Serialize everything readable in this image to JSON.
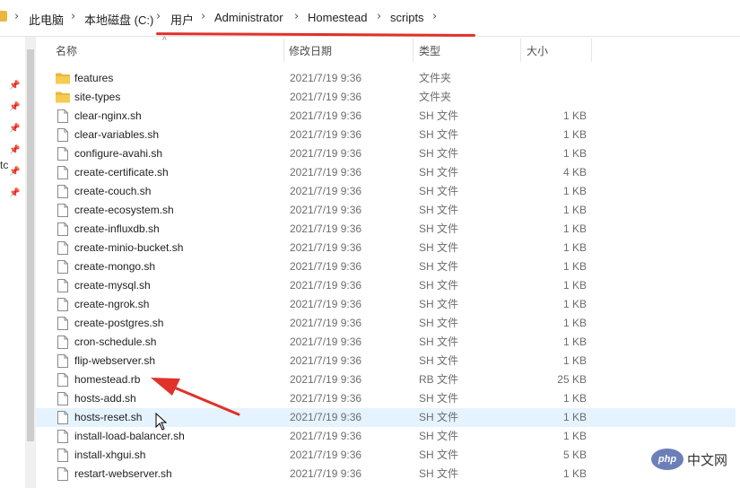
{
  "breadcrumb": [
    "此电脑",
    "本地磁盘 (C:)",
    "用户",
    "Administrator",
    "Homestead",
    "scripts"
  ],
  "columns": {
    "name": "名称",
    "date": "修改日期",
    "type": "类型",
    "size": "大小"
  },
  "nav_fragment": "tc",
  "files": [
    {
      "name": "features",
      "date": "2021/7/19 9:36",
      "type": "文件夹",
      "size": "",
      "kind": "folder"
    },
    {
      "name": "site-types",
      "date": "2021/7/19 9:36",
      "type": "文件夹",
      "size": "",
      "kind": "folder"
    },
    {
      "name": "clear-nginx.sh",
      "date": "2021/7/19 9:36",
      "type": "SH 文件",
      "size": "1 KB",
      "kind": "file"
    },
    {
      "name": "clear-variables.sh",
      "date": "2021/7/19 9:36",
      "type": "SH 文件",
      "size": "1 KB",
      "kind": "file"
    },
    {
      "name": "configure-avahi.sh",
      "date": "2021/7/19 9:36",
      "type": "SH 文件",
      "size": "1 KB",
      "kind": "file"
    },
    {
      "name": "create-certificate.sh",
      "date": "2021/7/19 9:36",
      "type": "SH 文件",
      "size": "4 KB",
      "kind": "file"
    },
    {
      "name": "create-couch.sh",
      "date": "2021/7/19 9:36",
      "type": "SH 文件",
      "size": "1 KB",
      "kind": "file"
    },
    {
      "name": "create-ecosystem.sh",
      "date": "2021/7/19 9:36",
      "type": "SH 文件",
      "size": "1 KB",
      "kind": "file"
    },
    {
      "name": "create-influxdb.sh",
      "date": "2021/7/19 9:36",
      "type": "SH 文件",
      "size": "1 KB",
      "kind": "file"
    },
    {
      "name": "create-minio-bucket.sh",
      "date": "2021/7/19 9:36",
      "type": "SH 文件",
      "size": "1 KB",
      "kind": "file"
    },
    {
      "name": "create-mongo.sh",
      "date": "2021/7/19 9:36",
      "type": "SH 文件",
      "size": "1 KB",
      "kind": "file"
    },
    {
      "name": "create-mysql.sh",
      "date": "2021/7/19 9:36",
      "type": "SH 文件",
      "size": "1 KB",
      "kind": "file"
    },
    {
      "name": "create-ngrok.sh",
      "date": "2021/7/19 9:36",
      "type": "SH 文件",
      "size": "1 KB",
      "kind": "file"
    },
    {
      "name": "create-postgres.sh",
      "date": "2021/7/19 9:36",
      "type": "SH 文件",
      "size": "1 KB",
      "kind": "file"
    },
    {
      "name": "cron-schedule.sh",
      "date": "2021/7/19 9:36",
      "type": "SH 文件",
      "size": "1 KB",
      "kind": "file"
    },
    {
      "name": "flip-webserver.sh",
      "date": "2021/7/19 9:36",
      "type": "SH 文件",
      "size": "1 KB",
      "kind": "file"
    },
    {
      "name": "homestead.rb",
      "date": "2021/7/19 9:36",
      "type": "RB 文件",
      "size": "25 KB",
      "kind": "file"
    },
    {
      "name": "hosts-add.sh",
      "date": "2021/7/19 9:36",
      "type": "SH 文件",
      "size": "1 KB",
      "kind": "file"
    },
    {
      "name": "hosts-reset.sh",
      "date": "2021/7/19 9:36",
      "type": "SH 文件",
      "size": "1 KB",
      "kind": "file",
      "hover": true
    },
    {
      "name": "install-load-balancer.sh",
      "date": "2021/7/19 9:36",
      "type": "SH 文件",
      "size": "1 KB",
      "kind": "file"
    },
    {
      "name": "install-xhgui.sh",
      "date": "2021/7/19 9:36",
      "type": "SH 文件",
      "size": "5 KB",
      "kind": "file"
    },
    {
      "name": "restart-webserver.sh",
      "date": "2021/7/19 9:36",
      "type": "SH 文件",
      "size": "1 KB",
      "kind": "file"
    }
  ],
  "watermark": {
    "logo": "php",
    "text": "中文网"
  },
  "colors": {
    "annotation": "#e0312a",
    "folder": "#e8b83c",
    "hover": "#e5f3ff"
  }
}
